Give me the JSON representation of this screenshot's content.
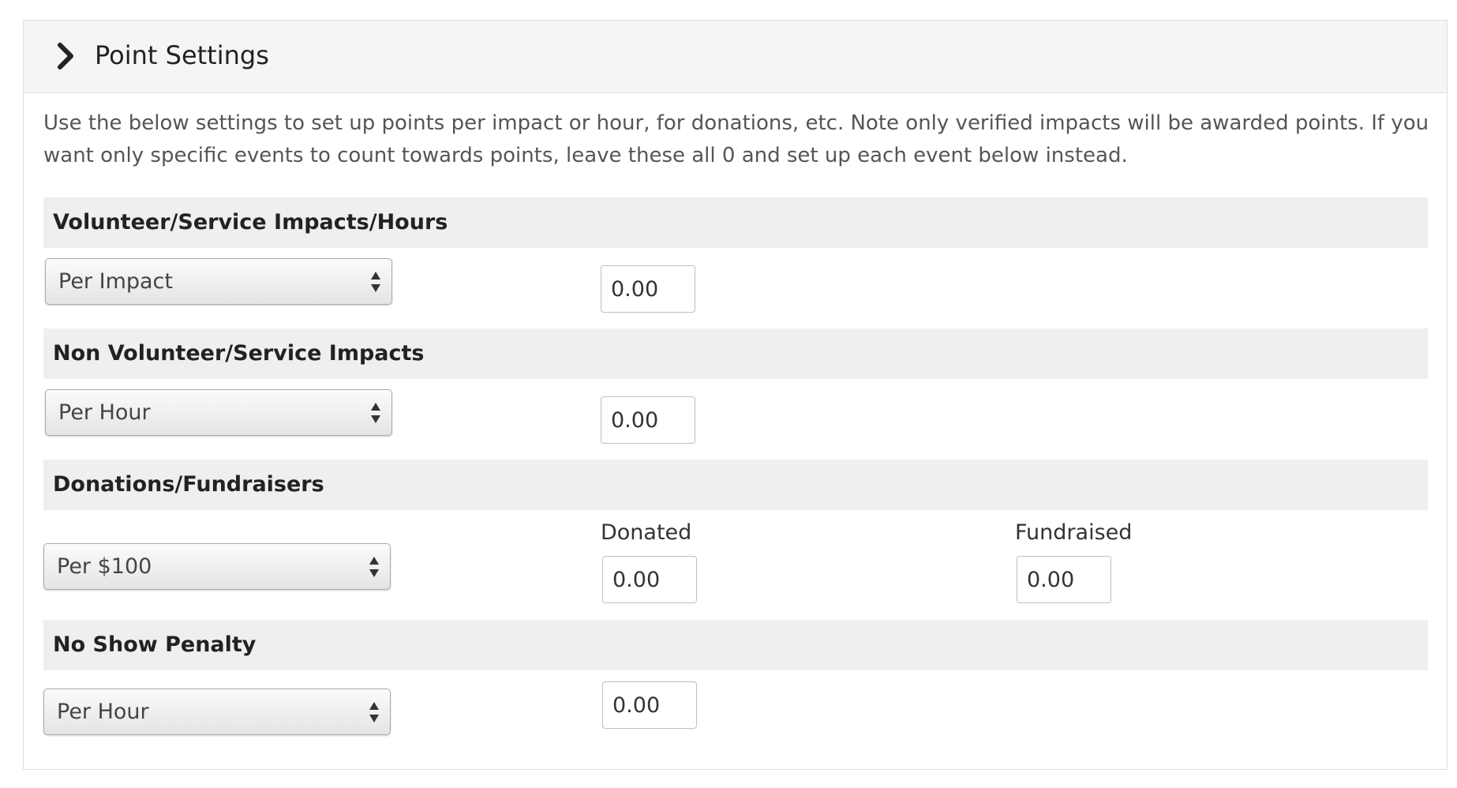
{
  "panel": {
    "title": "Point Settings",
    "intro": "Use the below settings to set up points per impact or hour, for donations, etc. Note only verified impacts will be awarded points. If you want only specific events to count towards points, leave these all 0 and set up each event below instead."
  },
  "icons": {
    "header": "chevron-right-icon",
    "select": "select-arrows-icon"
  },
  "sections": {
    "volunteer": {
      "title": "Volunteer/Service Impacts/Hours",
      "select_value": "Per Impact",
      "points": "0.00"
    },
    "non_volunteer": {
      "title": "Non Volunteer/Service Impacts",
      "select_value": "Per Hour",
      "points": "0.00"
    },
    "donations": {
      "title": "Donations/Fundraisers",
      "select_value": "Per $100",
      "donated_label": "Donated",
      "donated_points": "0.00",
      "fundraised_label": "Fundraised",
      "fundraised_points": "0.00"
    },
    "no_show": {
      "title": "No Show Penalty",
      "select_value": "Per Hour",
      "points": "0.00"
    }
  }
}
